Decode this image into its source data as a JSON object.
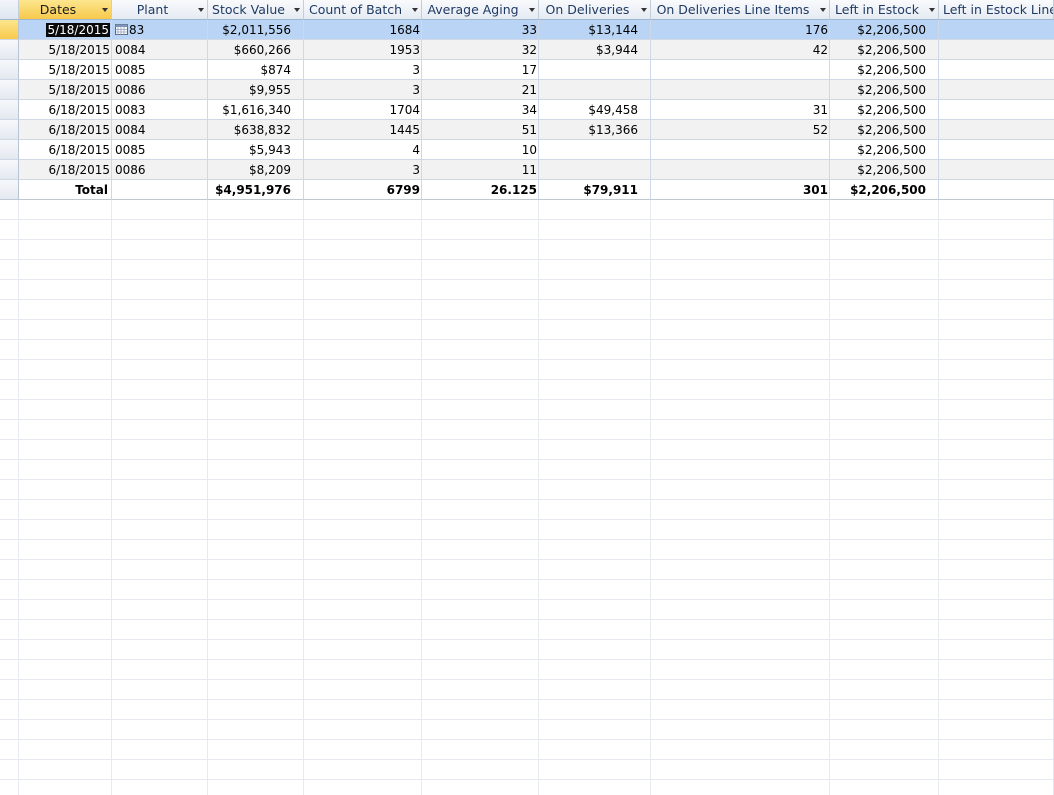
{
  "columns": [
    {
      "label": "Dates"
    },
    {
      "label": "Plant"
    },
    {
      "label": "Stock Value"
    },
    {
      "label": "Count of Batch"
    },
    {
      "label": "Average Aging"
    },
    {
      "label": "On Deliveries"
    },
    {
      "label": "On Deliveries Line Items"
    },
    {
      "label": "Left in Estock"
    },
    {
      "label": "Left in Estock Line"
    }
  ],
  "rows": [
    {
      "dates": "5/18/2015",
      "plant": "83",
      "stock_value": "$2,011,556",
      "count_batch": "1684",
      "avg_aging": "33",
      "on_deliveries": "$13,144",
      "on_del_items": "176",
      "left_estock": "$2,206,500",
      "left_estock_line": ""
    },
    {
      "dates": "5/18/2015",
      "plant": "0084",
      "stock_value": "$660,266",
      "count_batch": "1953",
      "avg_aging": "32",
      "on_deliveries": "$3,944",
      "on_del_items": "42",
      "left_estock": "$2,206,500",
      "left_estock_line": ""
    },
    {
      "dates": "5/18/2015",
      "plant": "0085",
      "stock_value": "$874",
      "count_batch": "3",
      "avg_aging": "17",
      "on_deliveries": "",
      "on_del_items": "",
      "left_estock": "$2,206,500",
      "left_estock_line": ""
    },
    {
      "dates": "5/18/2015",
      "plant": "0086",
      "stock_value": "$9,955",
      "count_batch": "3",
      "avg_aging": "21",
      "on_deliveries": "",
      "on_del_items": "",
      "left_estock": "$2,206,500",
      "left_estock_line": ""
    },
    {
      "dates": "6/18/2015",
      "plant": "0083",
      "stock_value": "$1,616,340",
      "count_batch": "1704",
      "avg_aging": "34",
      "on_deliveries": "$49,458",
      "on_del_items": "31",
      "left_estock": "$2,206,500",
      "left_estock_line": ""
    },
    {
      "dates": "6/18/2015",
      "plant": "0084",
      "stock_value": "$638,832",
      "count_batch": "1445",
      "avg_aging": "51",
      "on_deliveries": "$13,366",
      "on_del_items": "52",
      "left_estock": "$2,206,500",
      "left_estock_line": ""
    },
    {
      "dates": "6/18/2015",
      "plant": "0085",
      "stock_value": "$5,943",
      "count_batch": "4",
      "avg_aging": "10",
      "on_deliveries": "",
      "on_del_items": "",
      "left_estock": "$2,206,500",
      "left_estock_line": ""
    },
    {
      "dates": "6/18/2015",
      "plant": "0086",
      "stock_value": "$8,209",
      "count_batch": "3",
      "avg_aging": "11",
      "on_deliveries": "",
      "on_del_items": "",
      "left_estock": "$2,206,500",
      "left_estock_line": ""
    }
  ],
  "total": {
    "label": "Total",
    "stock_value": "$4,951,976",
    "count_batch": "6799",
    "avg_aging": "26.125",
    "on_deliveries": "$79,911",
    "on_del_items": "301",
    "left_estock": "$2,206,500"
  },
  "colors": {
    "selected_row": "#b9d4f5",
    "active_header": "#f7c94b",
    "gridline": "#d0d7e5"
  },
  "icons": {
    "date_picker": "calendar-icon",
    "column_menu": "chevron-down-icon"
  }
}
